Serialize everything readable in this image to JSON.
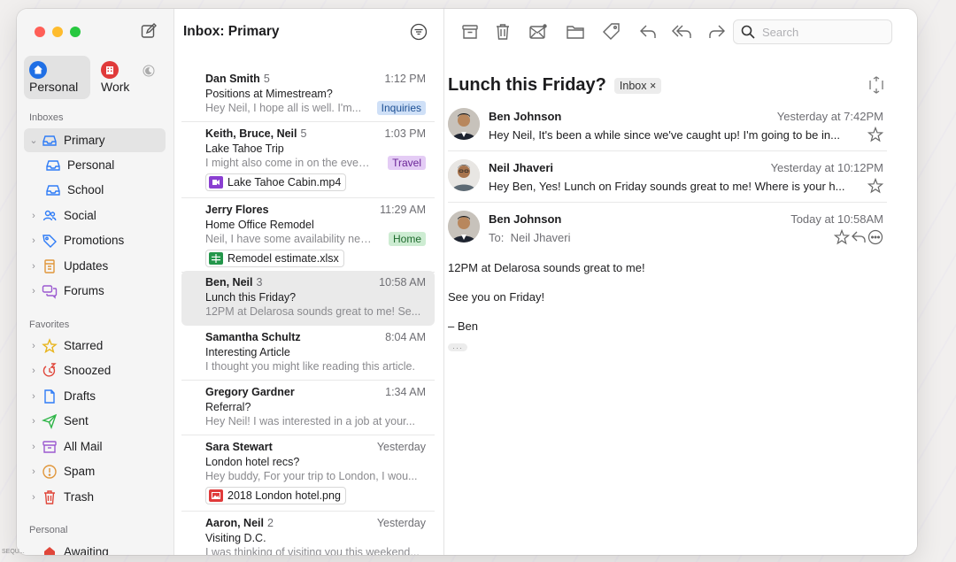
{
  "sidebar": {
    "accounts": [
      {
        "label": "Personal",
        "color": "#1f6fe5"
      },
      {
        "label": "Work",
        "color": "#e03a3a"
      }
    ],
    "sections": {
      "inboxes": "Inboxes",
      "favorites": "Favorites",
      "personal": "Personal"
    },
    "inboxes": [
      {
        "label": "Primary",
        "icon": "inbox-icon"
      },
      {
        "label": "Personal",
        "icon": "inbox-icon"
      },
      {
        "label": "School",
        "icon": "inbox-icon"
      },
      {
        "label": "Social",
        "icon": "social-icon"
      },
      {
        "label": "Promotions",
        "icon": "tag-icon"
      },
      {
        "label": "Updates",
        "icon": "updates-icon"
      },
      {
        "label": "Forums",
        "icon": "forums-icon"
      }
    ],
    "favorites": [
      {
        "label": "Starred",
        "icon": "star-icon"
      },
      {
        "label": "Snoozed",
        "icon": "snooze-icon"
      },
      {
        "label": "Drafts",
        "icon": "draft-icon"
      },
      {
        "label": "Sent",
        "icon": "sent-icon"
      },
      {
        "label": "All Mail",
        "icon": "archive-icon"
      },
      {
        "label": "Spam",
        "icon": "spam-icon"
      },
      {
        "label": "Trash",
        "icon": "trash-icon"
      }
    ],
    "personal": [
      {
        "label": "Awaiting",
        "icon": "label-icon"
      }
    ]
  },
  "list": {
    "title": "Inbox: Primary",
    "messages": [
      {
        "from": "Dan Smith",
        "count": "5",
        "time": "1:12 PM",
        "subject": "Positions at Mimestream?",
        "preview": "Hey Neil, I hope all is well. I'm...",
        "tag": "Inquiries",
        "tag_bg": "#cfe0f7",
        "tag_color": "#1c4f94"
      },
      {
        "from": "Keith, Bruce, Neil",
        "count": "5",
        "time": "1:03 PM",
        "subject": "Lake Tahoe Trip",
        "preview": "I might also come in on the eveni...",
        "tag": "Travel",
        "tag_bg": "#e4ccf5",
        "tag_color": "#6b2597",
        "attachment": "Lake Tahoe Cabin.mp4"
      },
      {
        "from": "Jerry Flores",
        "count": "",
        "time": "11:29 AM",
        "subject": "Home Office Remodel",
        "preview": "Neil, I have some availability next...",
        "tag": "Home",
        "tag_bg": "#cdecd2",
        "tag_color": "#1f6b2e",
        "attachment": "Remodel estimate.xlsx"
      },
      {
        "from": "Ben, Neil",
        "count": "3",
        "time": "10:58 AM",
        "subject": "Lunch this Friday?",
        "preview": "12PM at Delarosa sounds great to me! Se...",
        "tag": ""
      },
      {
        "from": "Samantha Schultz",
        "count": "",
        "time": "8:04 AM",
        "subject": "Interesting Article",
        "preview": "I thought you might like reading this article.",
        "tag": ""
      },
      {
        "from": "Gregory Gardner",
        "count": "",
        "time": "1:34 AM",
        "subject": "Referral?",
        "preview": "Hey Neil! I was interested in a job at your...",
        "tag": ""
      },
      {
        "from": "Sara Stewart",
        "count": "",
        "time": "Yesterday",
        "subject": "London hotel recs?",
        "preview": "Hey buddy, For your trip to London, I wou...",
        "tag": "",
        "attachment": "2018 London hotel.png"
      },
      {
        "from": "Aaron, Neil",
        "count": "2",
        "time": "Yesterday",
        "subject": "Visiting D.C.",
        "preview": "I was thinking of visiting you this weekend...",
        "tag": ""
      }
    ]
  },
  "reader": {
    "search_placeholder": "Search",
    "subject": "Lunch this Friday?",
    "label": "Inbox",
    "label_close": "×",
    "thread": [
      {
        "from": "Ben Johnson",
        "time": "Yesterday at 7:42PM",
        "preview": "Hey Neil, It's been a while since we've caught up! I'm going to be in..."
      },
      {
        "from": "Neil Jhaveri",
        "time": "Yesterday at 10:12PM",
        "preview": "Hey Ben, Yes! Lunch on Friday sounds great to me! Where is your h..."
      },
      {
        "from": "Ben Johnson",
        "time": "Today at 10:58AM",
        "to_label": "To:",
        "to": "Neil Jhaveri"
      }
    ],
    "body": [
      "12PM at Delarosa sounds great to me!",
      "See you on Friday!",
      "– Ben"
    ]
  },
  "footer_text": "SEQU..."
}
